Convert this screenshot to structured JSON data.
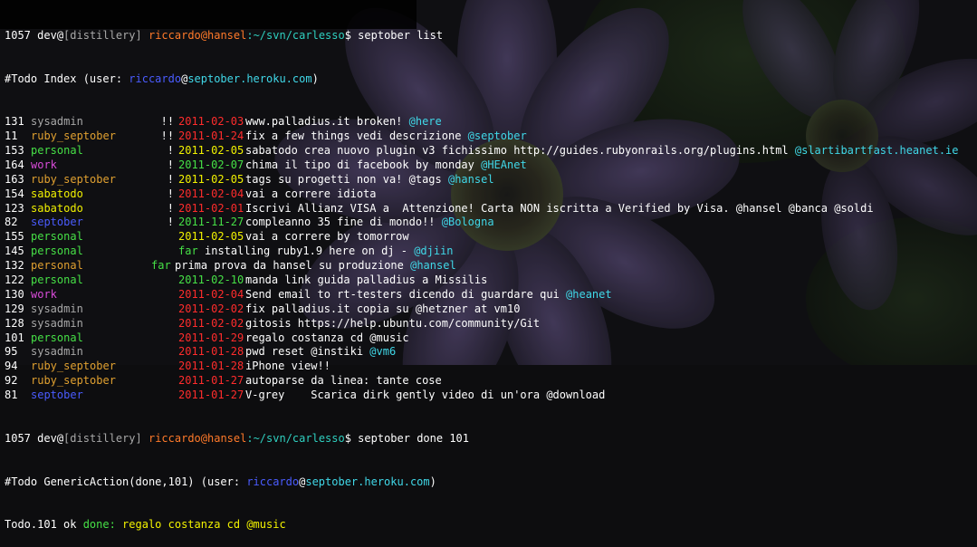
{
  "colors": {
    "background": "#0d0d0f",
    "text": "#ffffff",
    "sysadmin": "#a8a8a8",
    "ruby_septober": "#e0a030",
    "personal": "#46e046",
    "work": "#d84bd8",
    "sabatodo": "#f0f000",
    "septober": "#4a5cff",
    "date_red": "#ff2c2c",
    "date_yellow": "#f2f200",
    "date_green": "#46e046",
    "tag": "#40d8e8"
  },
  "prompt1": {
    "num": "1057",
    "user": "dev@",
    "env": "[distillery]",
    "host": "riccardo@hansel",
    "path": ":~/svn/carlesso",
    "cmd": "$ septober list"
  },
  "index_header": {
    "prefix": "#Todo Index (user: ",
    "user": "riccardo",
    "at": "@",
    "host": "septober.heroku.com",
    "suffix": ")"
  },
  "todos": [
    {
      "id": "131",
      "project": "sysadmin",
      "pcls": "proj-sysadmin",
      "mark": "!!",
      "date": "2011-02-03",
      "dcls": "d-red",
      "text": "www.palladius.it broken! ",
      "tag": "@here"
    },
    {
      "id": "11",
      "project": "ruby_septober",
      "pcls": "proj-ruby",
      "mark": "!!",
      "date": "2011-01-24",
      "dcls": "d-red",
      "text": "fix a few things vedi descrizione ",
      "tag": "@septober"
    },
    {
      "id": "153",
      "project": "personal",
      "pcls": "proj-personal",
      "mark": "!",
      "date": "2011-02-05",
      "dcls": "d-yellow",
      "text": "sabatodo crea nuovo plugin v3 fichissimo http://guides.rubyonrails.org/plugins.html ",
      "tag": "@slartibartfast.heanet.ie"
    },
    {
      "id": "164",
      "project": "work",
      "pcls": "proj-work",
      "mark": "!",
      "date": "2011-02-07",
      "dcls": "d-green",
      "text": "chima il tipo di facebook by monday ",
      "tag": "@HEAnet"
    },
    {
      "id": "163",
      "project": "ruby_septober",
      "pcls": "proj-ruby",
      "mark": "!",
      "date": "2011-02-05",
      "dcls": "d-yellow",
      "text": "tags su progetti non va! @tags ",
      "tag": "@hansel"
    },
    {
      "id": "154",
      "project": "sabatodo",
      "pcls": "proj-sabatodo",
      "mark": "!",
      "date": "2011-02-04",
      "dcls": "d-red",
      "text": "vai a correre idiota",
      "tag": ""
    },
    {
      "id": "123",
      "project": "sabatodo",
      "pcls": "proj-sabatodo",
      "mark": "!",
      "date": "2011-02-01",
      "dcls": "d-red",
      "text": "Iscrivi Allianz VISA a  Attenzione! Carta NON iscritta a Verified by Visa. @hansel @banca @soldi",
      "tag": ""
    },
    {
      "id": "82",
      "project": "septober",
      "pcls": "proj-septober",
      "mark": "!",
      "date": "2011-11-27",
      "dcls": "d-green",
      "text": "compleanno 35 fine di mondo!! ",
      "tag": "@Bologna"
    },
    {
      "id": "155",
      "project": "personal",
      "pcls": "proj-personal",
      "mark": "",
      "date": "2011-02-05",
      "dcls": "d-yellow",
      "text": "vai a correre by tomorrow",
      "tag": ""
    },
    {
      "id": "145",
      "project": "personal",
      "pcls": "proj-personal",
      "mark": "",
      "date": "far",
      "dcls": "d-green",
      "text": "installing ruby1.9 here on dj - ",
      "tag": "@djiin"
    },
    {
      "id": "132",
      "project": "personal",
      "pcls": "proj-ruby",
      "mark": "",
      "date": "far",
      "dcls": "d-green",
      "text": "prima prova da hansel su produzione ",
      "tag": "@hansel",
      "far_left": true
    },
    {
      "id": "122",
      "project": "personal",
      "pcls": "proj-personal",
      "mark": "",
      "date": "2011-02-10",
      "dcls": "d-green",
      "text": "manda link guida palladius a Missilis",
      "tag": ""
    },
    {
      "id": "130",
      "project": "work",
      "pcls": "proj-work",
      "mark": "",
      "date": "2011-02-04",
      "dcls": "d-red",
      "text": "Send email to rt-testers dicendo di guardare qui ",
      "tag": "@heanet"
    },
    {
      "id": "129",
      "project": "sysadmin",
      "pcls": "proj-sysadmin",
      "mark": "",
      "date": "2011-02-02",
      "dcls": "d-red",
      "text": "fix palladius.it copia su @hetzner at vm10",
      "tag": ""
    },
    {
      "id": "128",
      "project": "sysadmin",
      "pcls": "proj-sysadmin",
      "mark": "",
      "date": "2011-02-02",
      "dcls": "d-red",
      "text": "gitosis https://help.ubuntu.com/community/Git",
      "tag": ""
    },
    {
      "id": "101",
      "project": "personal",
      "pcls": "proj-personal",
      "mark": "",
      "date": "2011-01-29",
      "dcls": "d-red",
      "text": "regalo costanza cd @music",
      "tag": ""
    },
    {
      "id": "95",
      "project": "sysadmin",
      "pcls": "proj-sysadmin",
      "mark": "",
      "date": "2011-01-28",
      "dcls": "d-red",
      "text": "pwd reset @instiki ",
      "tag": "@vm6"
    },
    {
      "id": "94",
      "project": "ruby_septober",
      "pcls": "proj-ruby",
      "mark": "",
      "date": "2011-01-28",
      "dcls": "d-red",
      "text": "iPhone view!!",
      "tag": ""
    },
    {
      "id": "92",
      "project": "ruby_septober",
      "pcls": "proj-ruby",
      "mark": "",
      "date": "2011-01-27",
      "dcls": "d-red",
      "text": "autoparse da linea: tante cose",
      "tag": ""
    },
    {
      "id": "81",
      "project": "septober",
      "pcls": "proj-septober",
      "mark": "",
      "date": "2011-01-27",
      "dcls": "d-red",
      "text": "V-grey    Scarica dirk gently video di un'ora @download",
      "tag": ""
    }
  ],
  "prompt2": {
    "num": "1057",
    "user": "dev@",
    "env": "[distillery]",
    "host": "riccardo@hansel",
    "path": ":~/svn/carlesso",
    "cmd": "$ septober done 101"
  },
  "action_header": {
    "prefix": "#Todo GenericAction(done,101) (user: ",
    "user": "riccardo",
    "at": "@",
    "host": "septober.heroku.com",
    "suffix": ")"
  },
  "result": {
    "prefix": "Todo.101 ok ",
    "status": "done:",
    "text": " regalo costanza cd @music"
  }
}
